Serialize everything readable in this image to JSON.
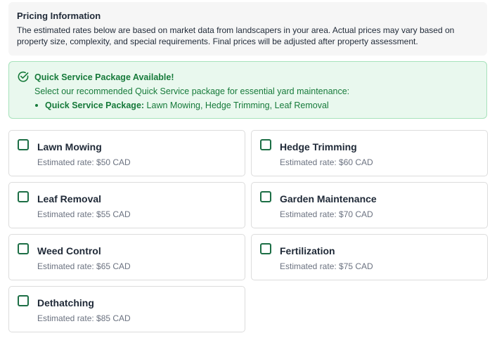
{
  "info": {
    "title": "Pricing Information",
    "line1": "The estimated rates below are based on market data from landscapers in your area. Actual prices may vary based on",
    "line2": "property size, complexity, and special requirements. Final prices will be adjusted after property assessment."
  },
  "quick_service": {
    "icon": "check-circle-icon",
    "title": "Quick Service Package Available!",
    "description": "Select our recommended Quick Service package for essential yard maintenance:",
    "package_label": "Quick Service Package:",
    "package_items": "Lawn Mowing, Hedge Trimming, Leaf Removal"
  },
  "services": [
    {
      "name": "Lawn Mowing",
      "rate": "Estimated rate: $50 CAD",
      "checked": false
    },
    {
      "name": "Hedge Trimming",
      "rate": "Estimated rate: $60 CAD",
      "checked": false
    },
    {
      "name": "Leaf Removal",
      "rate": "Estimated rate: $55 CAD",
      "checked": false
    },
    {
      "name": "Garden Maintenance",
      "rate": "Estimated rate: $70 CAD",
      "checked": false
    },
    {
      "name": "Weed Control",
      "rate": "Estimated rate: $65 CAD",
      "checked": false
    },
    {
      "name": "Fertilization",
      "rate": "Estimated rate: $75 CAD",
      "checked": false
    },
    {
      "name": "Dethatching",
      "rate": "Estimated rate: $85 CAD",
      "checked": false
    }
  ],
  "colors": {
    "accent_green": "#167a3a",
    "checkbox_border": "#1c6e45",
    "success_bg": "#e9f8ee",
    "success_border": "#a7e2bb"
  }
}
